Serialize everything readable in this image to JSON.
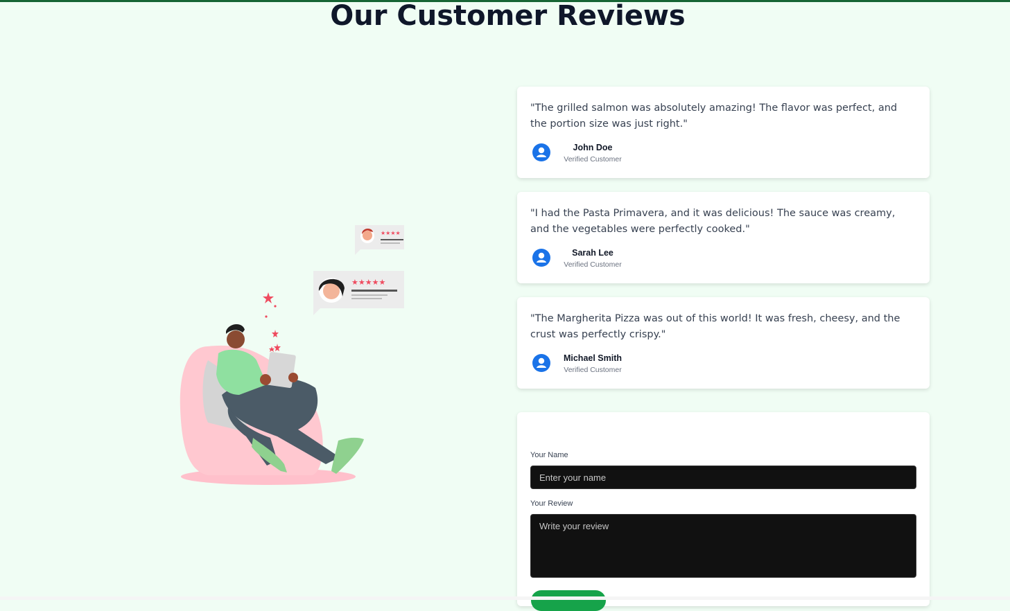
{
  "page": {
    "title": "Our Customer Reviews"
  },
  "reviews": [
    {
      "text": "\"The grilled salmon was absolutely amazing! The flavor was perfect, and the portion size was just right.\"",
      "name": "John Doe",
      "role": "Verified Customer",
      "icon": "user-circle-icon"
    },
    {
      "text": "\"I had the Pasta Primavera, and it was delicious! The sauce was creamy, and the vegetables were perfectly cooked.\"",
      "name": "Sarah Lee",
      "role": "Verified Customer",
      "icon": "user-circle-icon"
    },
    {
      "text": "\"The Margherita Pizza was out of this world! It was fresh, cheesy, and the crust was perfectly crispy.\"",
      "name": "Michael Smith",
      "role": "Verified Customer",
      "icon": "user-circle-icon"
    }
  ],
  "form": {
    "name_label": "Your Name",
    "name_placeholder": "Enter your name",
    "name_value": "",
    "review_label": "Your Review",
    "review_placeholder": "Write your review",
    "review_value": ""
  },
  "colors": {
    "background": "#f0fdf4",
    "accent": "#16a34a",
    "avatar_blue": "#1a73e8",
    "star_red": "#ef4b5f"
  }
}
